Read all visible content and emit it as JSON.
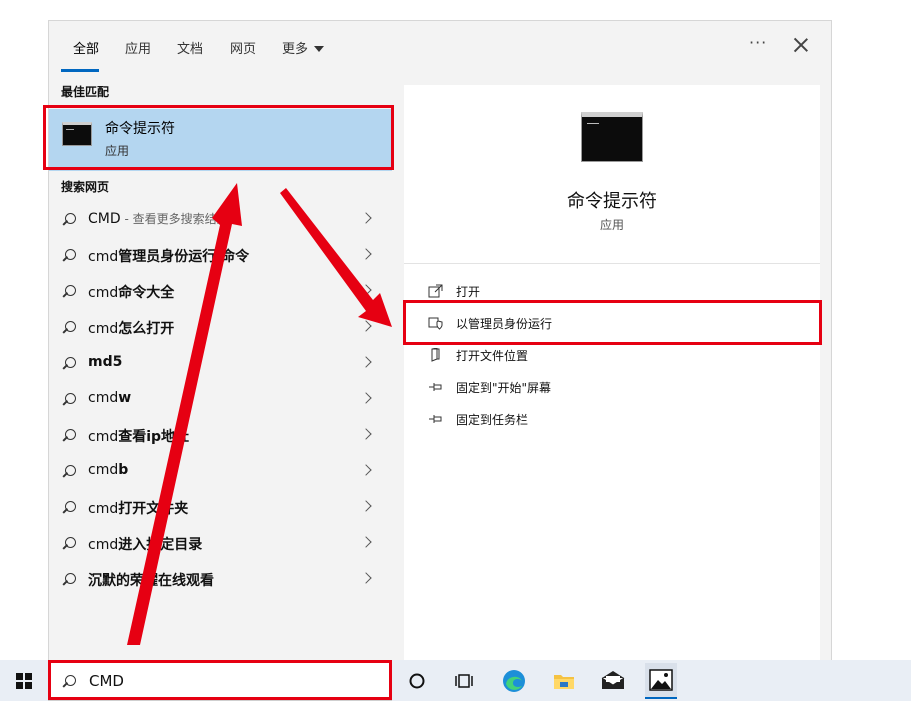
{
  "tabs": [
    {
      "label": "全部",
      "active": true
    },
    {
      "label": "应用"
    },
    {
      "label": "文档"
    },
    {
      "label": "网页"
    },
    {
      "label": "更多"
    }
  ],
  "toolbar": {
    "more_options": "···"
  },
  "best_match": {
    "section_label": "最佳匹配",
    "title": "命令提示符",
    "subtitle": "应用"
  },
  "web": {
    "section_label": "搜索网页",
    "items": [
      {
        "prefix": "CMD",
        "bold": "",
        "muted": " - 查看更多搜索结果"
      },
      {
        "prefix": "cmd",
        "bold": "管理员身份运行 命令",
        "muted": ""
      },
      {
        "prefix": "cmd",
        "bold": "命令大全",
        "muted": ""
      },
      {
        "prefix": "cmd",
        "bold": "怎么打开",
        "muted": ""
      },
      {
        "prefix": "",
        "bold": "md5",
        "muted": ""
      },
      {
        "prefix": "cmd",
        "bold": "w",
        "muted": ""
      },
      {
        "prefix": "cmd",
        "bold": "查看ip地址",
        "muted": ""
      },
      {
        "prefix": "cmd",
        "bold": "b",
        "muted": ""
      },
      {
        "prefix": "cmd",
        "bold": "打开文件夹",
        "muted": ""
      },
      {
        "prefix": "cmd",
        "bold": "进入指定目录",
        "muted": ""
      },
      {
        "prefix": "",
        "bold": "沉默的荣耀在线观看",
        "muted": ""
      }
    ]
  },
  "detail": {
    "title": "命令提示符",
    "subtitle": "应用",
    "actions": [
      {
        "label": "打开",
        "icon": "open-icon"
      },
      {
        "label": "以管理员身份运行",
        "icon": "shield-icon"
      },
      {
        "label": "打开文件位置",
        "icon": "folder-icon"
      },
      {
        "label": "固定到\"开始\"屏幕",
        "icon": "pin-icon"
      },
      {
        "label": "固定到任务栏",
        "icon": "pin-icon"
      }
    ]
  },
  "taskbar": {
    "search_value": "CMD",
    "icons": [
      "windows-start-icon",
      "cortana-icon",
      "task-view-icon",
      "edge-icon",
      "file-explorer-icon",
      "mail-icon",
      "photos-icon"
    ]
  },
  "colors": {
    "accent": "#0067c0",
    "selection": "#b4d6f0",
    "annotation": "#e60012"
  }
}
